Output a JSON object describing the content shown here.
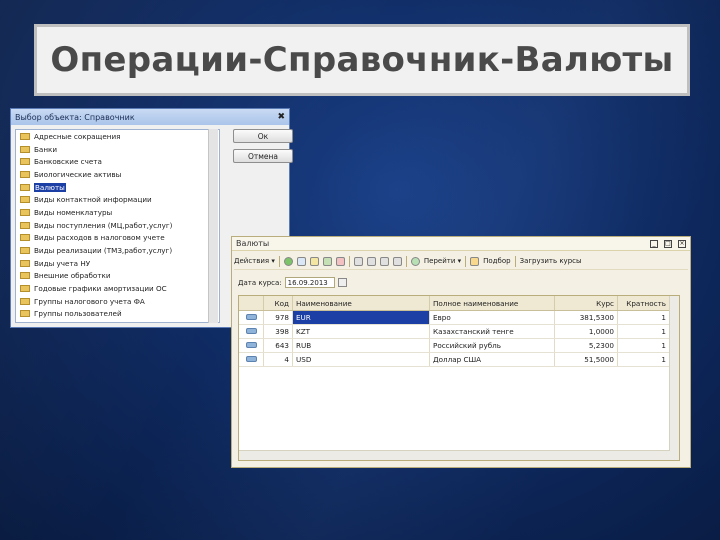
{
  "slide": {
    "title": "Операции-Справочник-Валюты"
  },
  "select_dialog": {
    "title": "Выбор объекта: Справочник",
    "close": "✖",
    "items": [
      "Адресные сокращения",
      "Банки",
      "Банковские счета",
      "Биологические активы",
      "Валюты",
      "Виды контактной информации",
      "Виды номенклатуры",
      "Виды поступления (МЦ,работ,услуг)",
      "Виды расходов в налоговом учете",
      "Виды реализации (ТМЗ,работ,услуг)",
      "Виды учета НУ",
      "Внешние обработки",
      "Годовые графики амортизации ОС",
      "Группы налогового учета ФА",
      "Группы пользователей"
    ],
    "selected_index": 4,
    "ok_label": "Ок",
    "cancel_label": "Отмена"
  },
  "currency_window": {
    "title": "Валюты",
    "controls": [
      "_",
      "□",
      "×"
    ],
    "toolbar": {
      "actions_label": "Действия ▾",
      "goto_label": "Перейти ▾",
      "select_label": "Подбор",
      "load_label": "Загрузить курсы"
    },
    "date_label": "Дата курса:",
    "date_value": "16.09.2013",
    "columns": [
      "Код",
      "Наименование",
      "Полное наименование",
      "Курс",
      "Кратность"
    ],
    "rows": [
      {
        "code": "978",
        "name": "EUR",
        "full_name": "Евро",
        "rate": "381,5300",
        "mult": "1"
      },
      {
        "code": "398",
        "name": "KZT",
        "full_name": "Казахстанский тенге",
        "rate": "1,0000",
        "mult": "1"
      },
      {
        "code": "643",
        "name": "RUB",
        "full_name": "Российский рубль",
        "rate": "5,2300",
        "mult": "1"
      },
      {
        "code": "4",
        "name": "USD",
        "full_name": "Доллар США",
        "rate": "51,5000",
        "mult": "1"
      }
    ]
  },
  "colors": {
    "background": "#0f2b63",
    "selection": "#1c3fa6",
    "title_text": "#4a4a4a"
  }
}
